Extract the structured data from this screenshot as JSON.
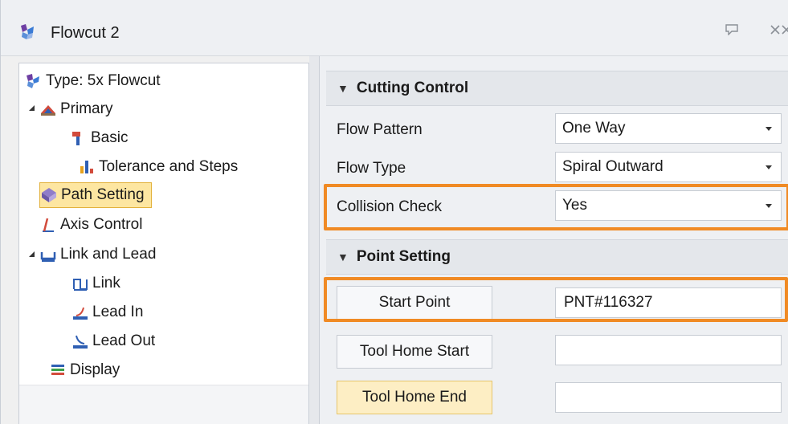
{
  "window": {
    "title": "Flowcut 2"
  },
  "tree": {
    "type_label": "Type: 5x Flowcut",
    "items": [
      {
        "label": "Primary",
        "icon": "primary-icon"
      },
      {
        "label": "Basic",
        "icon": "basic-icon"
      },
      {
        "label": "Tolerance and Steps",
        "icon": "tolerance-icon"
      },
      {
        "label": "Path Setting",
        "icon": "path-setting-icon",
        "selected": true
      },
      {
        "label": "Axis Control",
        "icon": "axis-control-icon"
      },
      {
        "label": "Link and Lead",
        "icon": "link-lead-icon"
      },
      {
        "label": "Link",
        "icon": "link-icon"
      },
      {
        "label": "Lead In",
        "icon": "lead-in-icon"
      },
      {
        "label": "Lead Out",
        "icon": "lead-out-icon"
      },
      {
        "label": "Display",
        "icon": "display-icon"
      }
    ]
  },
  "cutting_control": {
    "header": "Cutting Control",
    "flow_pattern": {
      "label": "Flow Pattern",
      "value": "One Way"
    },
    "flow_type": {
      "label": "Flow Type",
      "value": "Spiral Outward"
    },
    "collision_check": {
      "label": "Collision Check",
      "value": "Yes"
    }
  },
  "point_setting": {
    "header": "Point Setting",
    "start_point": {
      "label": "Start Point",
      "value": "PNT#116327"
    },
    "tool_home_start": {
      "label": "Tool Home Start",
      "value": ""
    },
    "tool_home_end": {
      "label": "Tool Home End",
      "value": ""
    }
  },
  "colors": {
    "highlight": "#f08a24",
    "selection": "#fde6a1"
  }
}
